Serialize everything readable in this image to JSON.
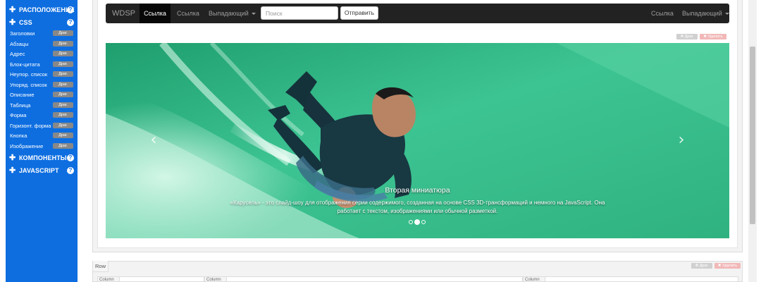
{
  "sidebar": {
    "categories": [
      {
        "label": "РАСПОЛОЖЕНИЕ",
        "help": "?"
      },
      {
        "label": "CSS",
        "help": "?"
      },
      {
        "label": "КОМПОНЕНТЫ",
        "help": "?"
      },
      {
        "label": "JAVASCRIPT",
        "help": "?"
      }
    ],
    "drag_label": "Драг.",
    "css_items": [
      "Заголовки",
      "Абзацы",
      "Адрес",
      "Блок-цитата",
      "Неупор. список",
      "Упоряд. список",
      "Описание",
      "Таблица",
      "Форма",
      "Горизонт. форма",
      "Кнопка",
      "Изображение"
    ]
  },
  "navbar": {
    "brand": "WDSP",
    "active_link": "Ссылка",
    "link": "Ссылка",
    "dropdown": "Выпадающий",
    "search_placeholder": "Поиск",
    "submit": "Отправить",
    "right_link": "Ссылка",
    "right_dropdown": "Выпадающий"
  },
  "controls": {
    "drag": "Драг.",
    "delete": "Удалить"
  },
  "carousel": {
    "caption_title": "Вторая миниатюра",
    "caption_text": "«Карусель» - это слайд-шоу для отображения серии содержимого, созданная на основе CSS 3D-трансформаций и немного на JavaScript. Она работает с текстом, изображениями или обычной разметкой.",
    "prev": "‹",
    "next": "›",
    "slide_count": 3,
    "active_slide": 2
  },
  "row": {
    "label": "Row",
    "columns": [
      "Column",
      "Column",
      "Column"
    ]
  },
  "colors": {
    "sidebar": "#0e6ee0",
    "navbar": "#222222",
    "water": "#3cbf8e"
  }
}
